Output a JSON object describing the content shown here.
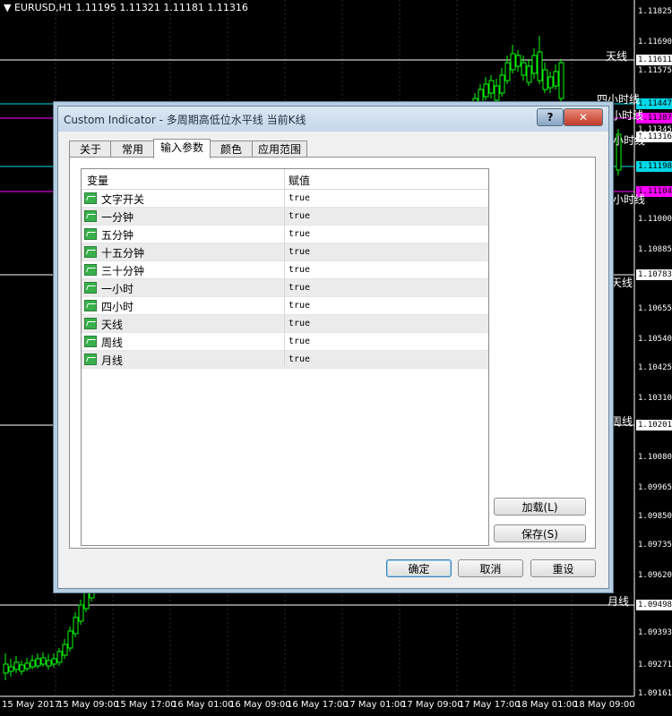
{
  "chart": {
    "header": "EURUSD,H1  1.11195 1.11321 1.11181 1.11316",
    "price_axis": [
      "1.11825",
      "1.11690",
      "1.11575",
      "1.11345",
      "1.11000",
      "1.10885",
      "1.10655",
      "1.10540",
      "1.10425",
      "1.10310",
      "1.10080",
      "1.09965",
      "1.09850",
      "1.09735",
      "1.09620",
      "1.09393",
      "1.09271",
      "1.09161"
    ],
    "badges": [
      {
        "label": "1.11611",
        "bg": "#ffffff",
        "fg": "#000000"
      },
      {
        "label": "1.11447",
        "bg": "#00d8e8",
        "fg": "#000000"
      },
      {
        "label": "1.11387",
        "bg": "#ff00ff",
        "fg": "#000000"
      },
      {
        "label": "1.11316",
        "bg": "#ffffff",
        "fg": "#000000"
      },
      {
        "label": "1.11198",
        "bg": "#00d8e8",
        "fg": "#000000"
      },
      {
        "label": "1.11104",
        "bg": "#ff00ff",
        "fg": "#000000"
      },
      {
        "label": "1.10783",
        "bg": "#ffffff",
        "fg": "#000000"
      },
      {
        "label": "1.10201",
        "bg": "#ffffff",
        "fg": "#000000"
      },
      {
        "label": "1.09498",
        "bg": "#ffffff",
        "fg": "#000000"
      }
    ],
    "line_labels": [
      "天线",
      "四小时线",
      "小时线",
      "小时线",
      "小时线",
      "天线",
      "周线",
      "月线"
    ],
    "time_axis": [
      "15 May 2017",
      "15 May 09:00",
      "15 May 17:00",
      "16 May 01:00",
      "16 May 09:00",
      "16 May 17:00",
      "17 May 01:00",
      "17 May 09:00",
      "17 May 17:00",
      "18 May 01:00",
      "18 May 09:00"
    ]
  },
  "dialog": {
    "title": "Custom Indicator - 多周期高低位水平线 当前K线",
    "help_label": "?",
    "close_label": "✕",
    "tabs": [
      "关于",
      "常用",
      "输入参数",
      "颜色",
      "应用范围"
    ],
    "active_tab": "输入参数",
    "columns": [
      "变量",
      "赋值"
    ],
    "params": [
      {
        "name": "文字开关",
        "value": "true"
      },
      {
        "name": "一分钟",
        "value": "true"
      },
      {
        "name": "五分钟",
        "value": "true"
      },
      {
        "name": "十五分钟",
        "value": "true"
      },
      {
        "name": "三十分钟",
        "value": "true"
      },
      {
        "name": "一小时",
        "value": "true"
      },
      {
        "name": "四小时",
        "value": "true"
      },
      {
        "name": "天线",
        "value": "true"
      },
      {
        "name": "周线",
        "value": "true"
      },
      {
        "name": "月线",
        "value": "true"
      }
    ],
    "load_label": "加载(L)",
    "save_label": "保存(S)",
    "ok_label": "确定",
    "cancel_label": "取消",
    "reset_label": "重设"
  },
  "icons": {
    "param": "indicator-param-icon",
    "menu": "dropdown-triangle-icon"
  },
  "colors": {
    "bull": "#00ff00",
    "line_white": "#ffffff",
    "line_cyan": "#00d8e8",
    "line_magenta": "#ff00ff"
  }
}
